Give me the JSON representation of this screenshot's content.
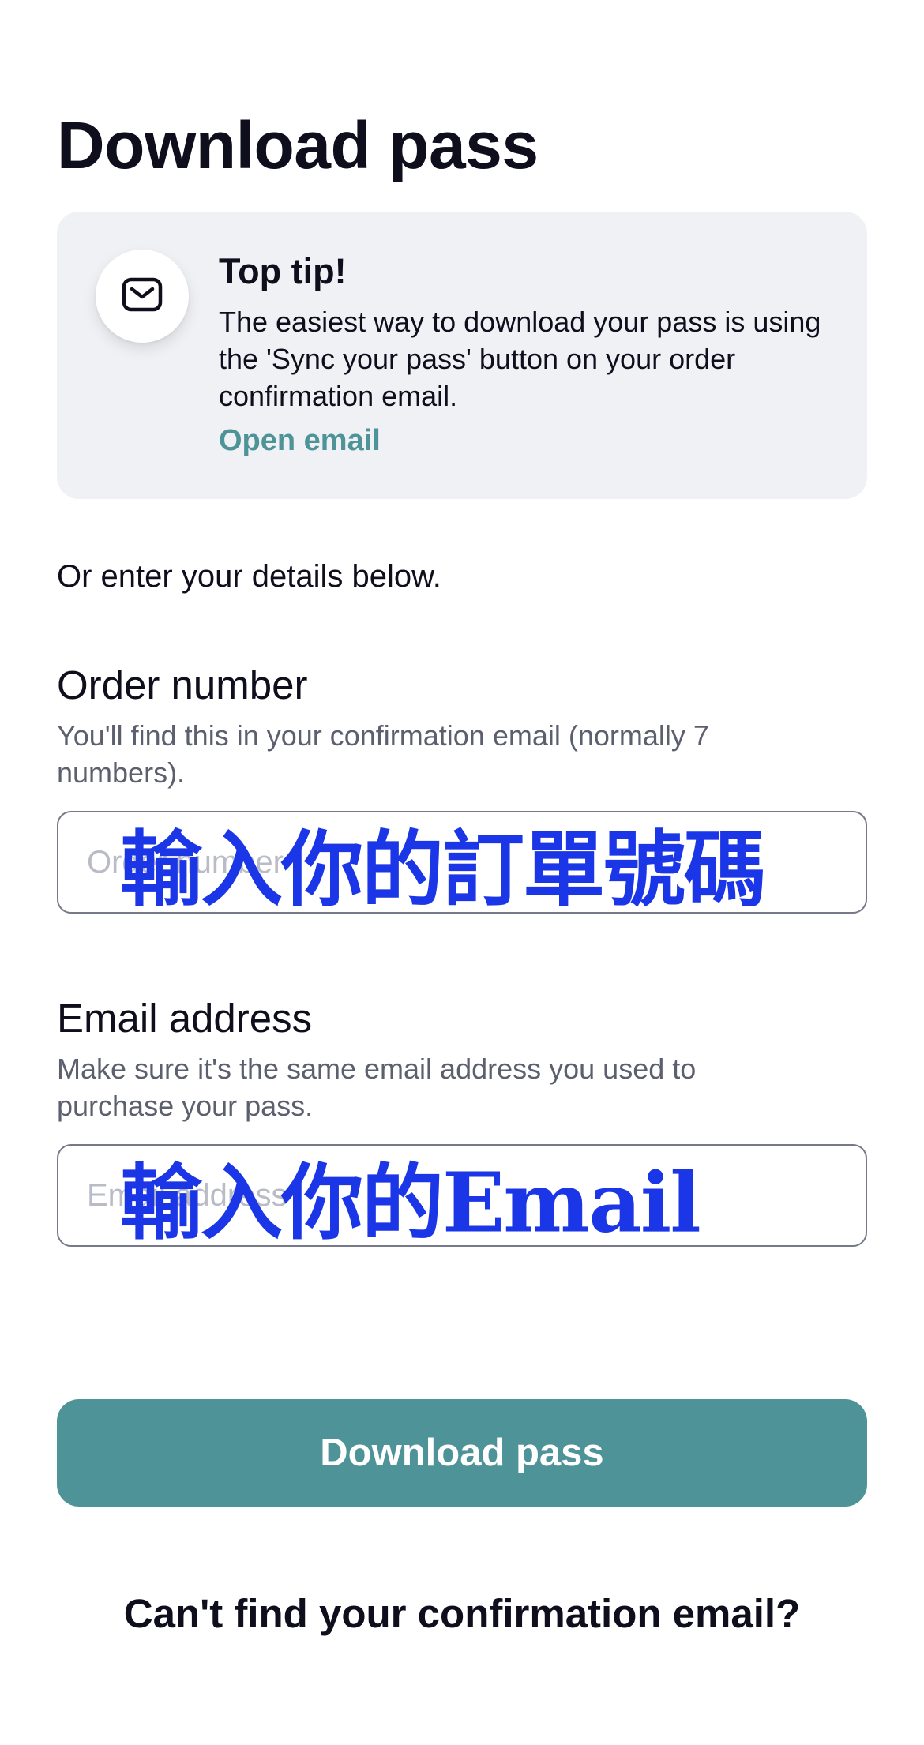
{
  "header": {
    "title": "Download pass"
  },
  "tip": {
    "icon": "email-icon",
    "title": "Top tip!",
    "body": "The easiest way to download your pass is using the 'Sync your pass' button on your order confirmation email.",
    "link_label": "Open email"
  },
  "intro": "Or enter your details below.",
  "order_field": {
    "label": "Order number",
    "hint": "You'll find this in your confirmation email (normally 7 numbers).",
    "placeholder": "Order number",
    "value": "",
    "overlay": "輸入你的訂單號碼"
  },
  "email_field": {
    "label": "Email address",
    "hint": "Make sure it's the same email address you used to purchase your pass.",
    "placeholder": "Email address",
    "value": "",
    "overlay": "輸入你的Email"
  },
  "download_button": {
    "label": "Download pass"
  },
  "help_link": {
    "label": "Can't find your confirmation email?"
  },
  "colors": {
    "accent": "#4e9398",
    "overlay": "#1a36e6",
    "card_bg": "#f0f1f5"
  }
}
